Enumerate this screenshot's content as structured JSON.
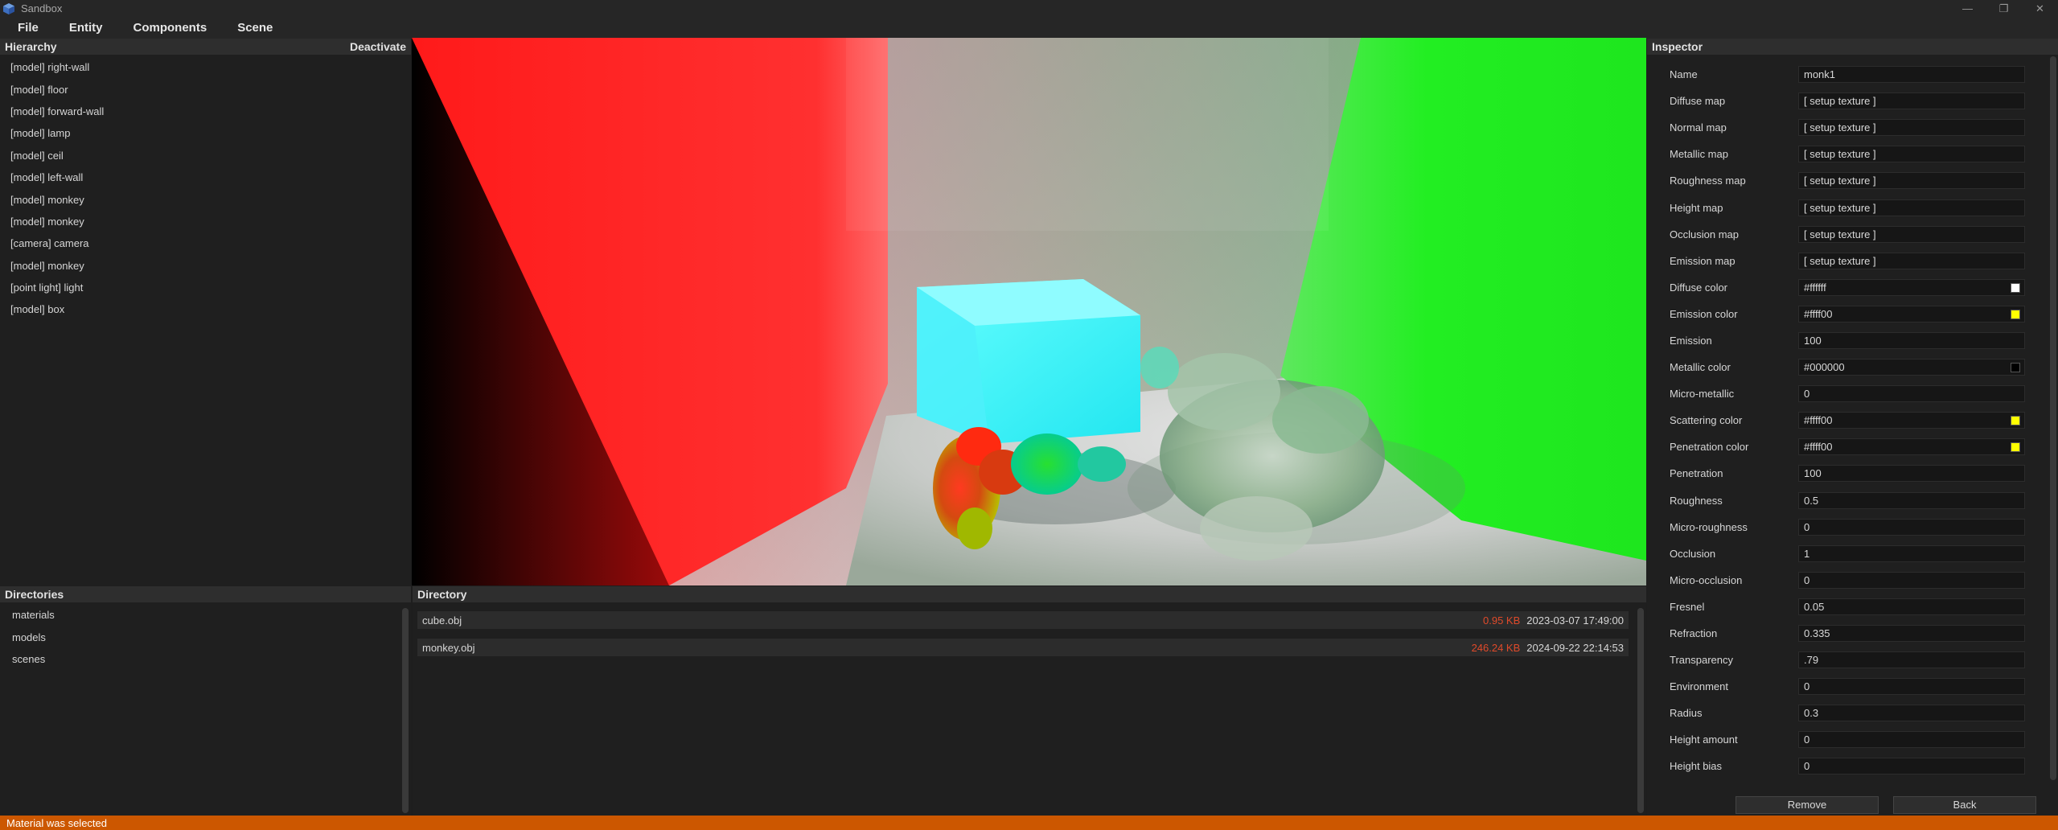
{
  "window": {
    "title": "Sandbox",
    "app_icon": "cube-icon",
    "controls": [
      "minimize-icon",
      "restore-icon",
      "close-icon"
    ]
  },
  "menu": [
    "File",
    "Entity",
    "Components",
    "Scene"
  ],
  "hierarchy": {
    "title": "Hierarchy",
    "action": "Deactivate",
    "items": [
      "[model] right-wall",
      "[model] floor",
      "[model] forward-wall",
      "[model] lamp",
      "[model] ceil",
      "[model] left-wall",
      "[model] monkey",
      "[model] monkey",
      "[camera] camera",
      "[model] monkey",
      "[point light] light",
      "[model] box"
    ]
  },
  "inspector": {
    "title": "Inspector",
    "fields": [
      {
        "label": "Name",
        "value": "monk1"
      },
      {
        "label": "Diffuse map",
        "value": "[ setup texture ]"
      },
      {
        "label": "Normal map",
        "value": "[ setup texture ]"
      },
      {
        "label": "Metallic map",
        "value": "[ setup texture ]"
      },
      {
        "label": "Roughness map",
        "value": "[ setup texture ]"
      },
      {
        "label": "Height map",
        "value": "[ setup texture ]"
      },
      {
        "label": "Occlusion map",
        "value": "[ setup texture ]"
      },
      {
        "label": "Emission map",
        "value": "[ setup texture ]"
      },
      {
        "label": "Diffuse color",
        "value": "#ffffff",
        "swatch": "#ffffff"
      },
      {
        "label": "Emission color",
        "value": "#ffff00",
        "swatch": "#ffff00"
      },
      {
        "label": "Emission",
        "value": "100"
      },
      {
        "label": "Metallic color",
        "value": "#000000",
        "swatch": "#000000"
      },
      {
        "label": "Micro-metallic",
        "value": "0"
      },
      {
        "label": "Scattering color",
        "value": "#ffff00",
        "swatch": "#ffff00"
      },
      {
        "label": "Penetration color",
        "value": "#ffff00",
        "swatch": "#ffff00"
      },
      {
        "label": "Penetration",
        "value": "100"
      },
      {
        "label": "Roughness",
        "value": "0.5"
      },
      {
        "label": "Micro-roughness",
        "value": "0"
      },
      {
        "label": "Occlusion",
        "value": "1"
      },
      {
        "label": "Micro-occlusion",
        "value": "0"
      },
      {
        "label": "Fresnel",
        "value": "0.05"
      },
      {
        "label": "Refraction",
        "value": "0.335"
      },
      {
        "label": "Transparency",
        "value": ".79"
      },
      {
        "label": "Environment",
        "value": "0"
      },
      {
        "label": "Radius",
        "value": "0.3"
      },
      {
        "label": "Height amount",
        "value": "0"
      },
      {
        "label": "Height bias",
        "value": "0"
      }
    ],
    "buttons": {
      "remove": "Remove",
      "back": "Back"
    }
  },
  "directories": {
    "title": "Directories",
    "items": [
      "materials",
      "models",
      "scenes"
    ]
  },
  "directory": {
    "title": "Directory",
    "files": [
      {
        "name": "cube.obj",
        "size": "0.95 KB",
        "modified": "2023-03-07 17:49:00"
      },
      {
        "name": "monkey.obj",
        "size": "246.24 KB",
        "modified": "2024-09-22 22:14:53"
      }
    ]
  },
  "status": "Material was selected",
  "colors": {
    "status_bar": "#cc5700",
    "file_size": "#e04a2a",
    "panel_bg": "#1f1f1f"
  }
}
